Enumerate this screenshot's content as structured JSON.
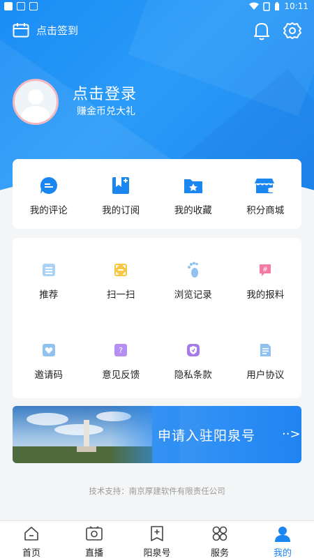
{
  "status_bar": {
    "time": "10:11"
  },
  "header": {
    "checkin_label": "点击签到",
    "login_title": "点击登录",
    "login_subtitle": "赚金币兑大礼"
  },
  "quick_actions": [
    {
      "label": "我的评论",
      "icon": "comment-icon"
    },
    {
      "label": "我的订阅",
      "icon": "subscribe-icon"
    },
    {
      "label": "我的收藏",
      "icon": "favorite-folder-icon"
    },
    {
      "label": "积分商城",
      "icon": "points-store-icon"
    }
  ],
  "tools_row1": [
    {
      "label": "推荐",
      "icon": "recommend-icon"
    },
    {
      "label": "扫一扫",
      "icon": "scan-icon"
    },
    {
      "label": "浏览记录",
      "icon": "footprint-icon"
    },
    {
      "label": "我的报料",
      "icon": "report-icon"
    }
  ],
  "tools_row2": [
    {
      "label": "邀请码",
      "icon": "invite-code-icon"
    },
    {
      "label": "意见反馈",
      "icon": "feedback-icon"
    },
    {
      "label": "隐私条款",
      "icon": "privacy-icon"
    },
    {
      "label": "用户协议",
      "icon": "user-agreement-icon"
    }
  ],
  "banner": {
    "text": "申请入驻阳泉号",
    "arrow": "··>"
  },
  "footer": {
    "support": "技术支持：南京厚建软件有限责任公司"
  },
  "tabs": [
    {
      "label": "首页",
      "icon": "home-icon"
    },
    {
      "label": "直播",
      "icon": "live-camera-icon"
    },
    {
      "label": "阳泉号",
      "icon": "yangquan-account-icon"
    },
    {
      "label": "服务",
      "icon": "services-icon"
    },
    {
      "label": "我的",
      "icon": "profile-icon"
    }
  ],
  "colors": {
    "accent": "#1a86f0",
    "header_blue": "#2a9bf8",
    "icon_pale_blue": "#9cc9f2",
    "icon_orange": "#f5b728",
    "icon_pink": "#f26b9c",
    "icon_purple": "#a67be8"
  }
}
